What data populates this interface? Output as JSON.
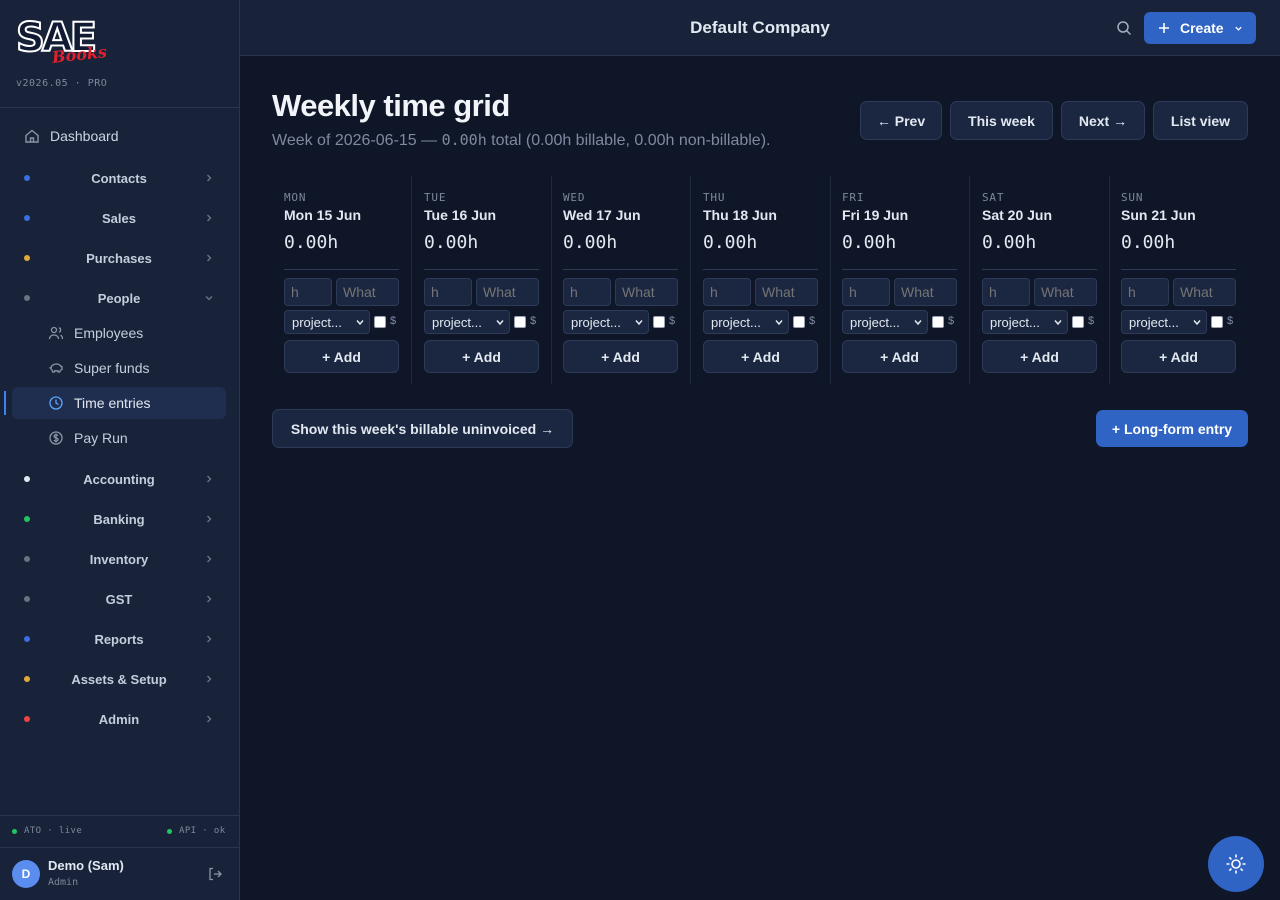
{
  "brand": {
    "logo_main": "SAE",
    "logo_sub": "Books",
    "version": "v2026.05 · PRO"
  },
  "colors": {
    "accent": "#2f63c4",
    "active_bg": "#1f2e4f",
    "sidebar_bg": "#18233a",
    "page_bg": "#0e1628"
  },
  "sidebar": {
    "dashboard": {
      "label": "Dashboard",
      "icon": "home-icon"
    },
    "groups": [
      {
        "label": "Contacts",
        "dot": "#3b6fe0"
      },
      {
        "label": "Sales",
        "dot": "#3b6fe0"
      },
      {
        "label": "Purchases",
        "dot": "#e2a93b"
      },
      {
        "label": "People",
        "dot": "#6b7280",
        "expanded": true
      },
      {
        "label": "Accounting",
        "dot": "#e2e8f0"
      },
      {
        "label": "Banking",
        "dot": "#22c55e"
      },
      {
        "label": "Inventory",
        "dot": "#6b7280"
      },
      {
        "label": "GST",
        "dot": "#6b7280"
      },
      {
        "label": "Reports",
        "dot": "#3b6fe0"
      },
      {
        "label": "Assets & Setup",
        "dot": "#e2a93b"
      },
      {
        "label": "Admin",
        "dot": "#ef4444"
      }
    ],
    "people_items": [
      {
        "label": "Employees",
        "icon": "users-icon"
      },
      {
        "label": "Super funds",
        "icon": "piggy-bank-icon"
      },
      {
        "label": "Time entries",
        "icon": "clock-icon",
        "active": true
      },
      {
        "label": "Pay Run",
        "icon": "dollar-circle-icon"
      }
    ],
    "status": {
      "ato": "ATO · live",
      "api": "API · ok"
    },
    "user": {
      "initial": "D",
      "name": "Demo (Sam)",
      "role": "Admin"
    }
  },
  "topbar": {
    "company": "Default Company",
    "create_label": "Create"
  },
  "page": {
    "title": "Weekly time grid",
    "subtitle_prefix": "Week of 2026-06-15 — ",
    "subtitle_total": "0.00h",
    "subtitle_suffix": " total (0.00h billable, 0.00h non-billable).",
    "nav": {
      "prev": "← Prev",
      "this_week": "This week",
      "next": "Next →",
      "list_view": "List view"
    },
    "days": [
      {
        "dow": "MON",
        "label": "Mon 15 Jun",
        "hours": "0.00h"
      },
      {
        "dow": "TUE",
        "label": "Tue 16 Jun",
        "hours": "0.00h"
      },
      {
        "dow": "WED",
        "label": "Wed 17 Jun",
        "hours": "0.00h"
      },
      {
        "dow": "THU",
        "label": "Thu 18 Jun",
        "hours": "0.00h"
      },
      {
        "dow": "FRI",
        "label": "Fri 19 Jun",
        "hours": "0.00h"
      },
      {
        "dow": "SAT",
        "label": "Sat 20 Jun",
        "hours": "0.00h"
      },
      {
        "dow": "SUN",
        "label": "Sun 21 Jun",
        "hours": "0.00h"
      }
    ],
    "entry": {
      "hours_placeholder": "h",
      "what_placeholder": "What",
      "project_select": "project...",
      "billable_symbol": "$",
      "add_label": "+ Add"
    },
    "uninvoiced_link": "Show this week's billable uninvoiced →",
    "long_form_label": "+ Long-form entry"
  }
}
